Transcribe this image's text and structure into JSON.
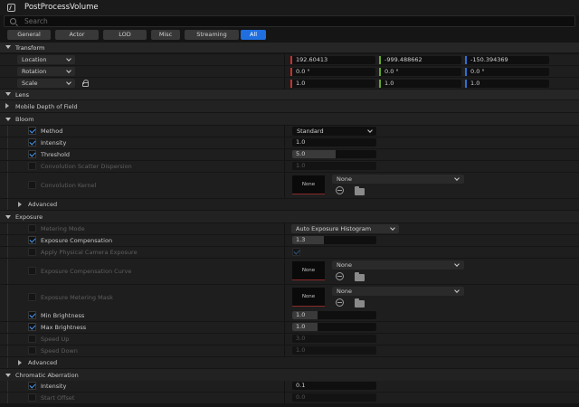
{
  "window": {
    "title": "PostProcessVolume"
  },
  "search": {
    "placeholder": "Search"
  },
  "tabs": [
    "General",
    "Actor",
    "LOD",
    "Misc",
    "Streaming",
    "All"
  ],
  "active_tab": "All",
  "transform": {
    "header": "Transform",
    "location_label": "Location",
    "rotation_label": "Rotation",
    "scale_label": "Scale",
    "location": [
      "192.60413",
      "-999.488662",
      "-150.394369"
    ],
    "rotation": [
      "0.0 °",
      "0.0 °",
      "0.0 °"
    ],
    "scale": [
      "1.0",
      "1.0",
      "1.0"
    ],
    "axis_colors": [
      "#c8302e",
      "#5fa82d",
      "#2c6fd8"
    ]
  },
  "lens": {
    "header": "Lens",
    "mobile_dof": "Mobile Depth of Field"
  },
  "bloom": {
    "header": "Bloom",
    "method_label": "Method",
    "method_value": "Standard",
    "intensity_label": "Intensity",
    "intensity_value": "1.0",
    "threshold_label": "Threshold",
    "threshold_value": "5.0",
    "threshold_fill": 0.52,
    "scatter_label": "Convolution Scatter Dispersion",
    "scatter_value": "1.0",
    "kernel_label": "Convolution Kernel",
    "kernel_thumb": "None",
    "kernel_asset": "None",
    "advanced": "Advanced"
  },
  "exposure": {
    "header": "Exposure",
    "metering_mode_label": "Metering Mode",
    "metering_mode_value": "Auto Exposure Histogram",
    "comp_label": "Exposure Compensation",
    "comp_value": "1.3",
    "comp_fill": 0.38,
    "physical_label": "Apply Physical Camera Exposure",
    "comp_curve_label": "Exposure Compensation Curve",
    "comp_curve_thumb": "None",
    "comp_curve_asset": "None",
    "mask_label": "Exposure Metering Mask",
    "mask_thumb": "None",
    "mask_asset": "None",
    "min_label": "Min Brightness",
    "min_value": "1.0",
    "min_fill": 0.3,
    "max_label": "Max Brightness",
    "max_value": "1.0",
    "max_fill": 0.3,
    "speed_up_label": "Speed Up",
    "speed_up_value": "3.0",
    "speed_down_label": "Speed Down",
    "speed_down_value": "1.0",
    "advanced": "Advanced"
  },
  "chromatic": {
    "header": "Chromatic Aberration",
    "intensity_label": "Intensity",
    "intensity_value": "0.1",
    "offset_label": "Start Offset",
    "offset_value": "0.0"
  }
}
